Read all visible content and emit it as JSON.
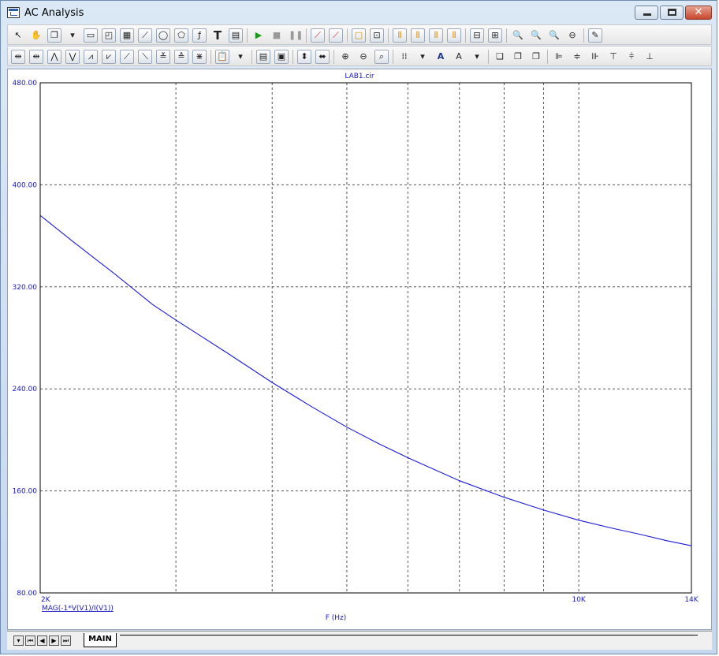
{
  "window": {
    "title": "AC Analysis"
  },
  "plot": {
    "title": "LAB1.cir",
    "trace_label": "MAG(-1*V(V1)/I(V1))",
    "x_axis_label": "F (Hz)"
  },
  "sheet_tabs": {
    "active": "MAIN"
  },
  "colors": {
    "trace": "#1a1ae0",
    "axis_text": "#1818c8",
    "grid": "#555555"
  },
  "chart_data": {
    "type": "line",
    "xlabel": "F (Hz)",
    "ylabel": "",
    "x_scale": "log",
    "xlim": [
      2000,
      14000
    ],
    "ylim": [
      80,
      480
    ],
    "x_ticks": [
      {
        "value": 2000,
        "label": "2K"
      },
      {
        "value": 10000,
        "label": "10K"
      },
      {
        "value": 14000,
        "label": "14K"
      }
    ],
    "x_grid": [
      3000,
      4000,
      5000,
      6000,
      7000,
      8000,
      9000,
      10000
    ],
    "y_ticks": [
      {
        "value": 80,
        "label": "80.00"
      },
      {
        "value": 160,
        "label": "160.00"
      },
      {
        "value": 240,
        "label": "240.00"
      },
      {
        "value": 320,
        "label": "320.00"
      },
      {
        "value": 400,
        "label": "400.00"
      },
      {
        "value": 480,
        "label": "480.00"
      }
    ],
    "grid": true,
    "series": [
      {
        "name": "MAG(-1*V(V1)/I(V1))",
        "x": [
          2000,
          2200,
          2500,
          2800,
          3000,
          3500,
          4000,
          4500,
          5000,
          5500,
          6000,
          7000,
          8000,
          9000,
          10000,
          11000,
          12000,
          13000,
          14000
        ],
        "y": [
          376,
          356,
          330,
          306,
          294,
          268,
          245,
          226,
          210,
          197,
          186,
          168,
          155,
          145,
          137,
          131,
          126,
          121,
          117
        ]
      }
    ]
  }
}
